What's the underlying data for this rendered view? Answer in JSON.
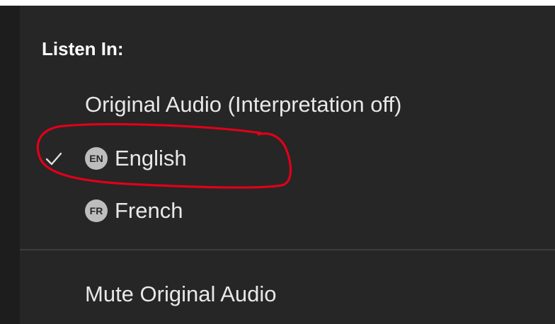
{
  "menu": {
    "heading": "Listen In:",
    "items": [
      {
        "label": "Original Audio (Interpretation off)",
        "checked": false
      },
      {
        "badge": "EN",
        "label": "English",
        "checked": true
      },
      {
        "badge": "FR",
        "label": "French",
        "checked": false
      }
    ],
    "mute_label": "Mute Original Audio"
  },
  "colors": {
    "menu_background": "#262626",
    "text": "#e8e8e8",
    "badge": "#bdbdbd",
    "annotation": "#e0001a"
  },
  "icons": {
    "check": "check-icon",
    "annotation": "hand-drawn-circle"
  }
}
